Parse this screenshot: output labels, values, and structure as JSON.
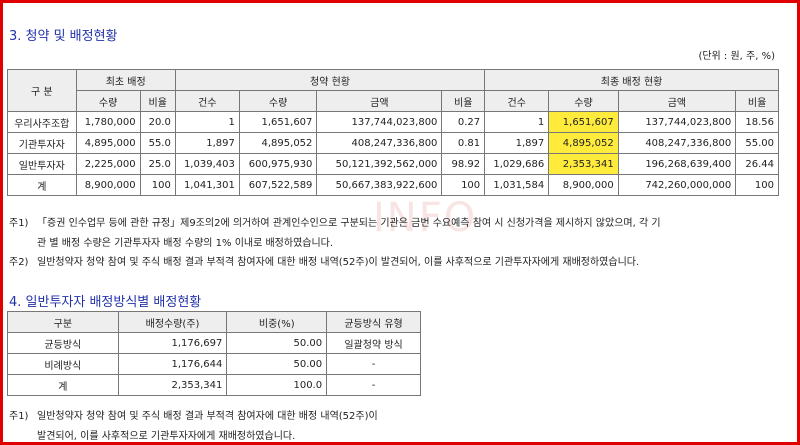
{
  "section3": {
    "title": "3. 청약 및 배정현황",
    "unit": "(단위 : 원, 주, %)",
    "header": {
      "classification": "구 분",
      "initial": "최초 배정",
      "subscription": "청약 현황",
      "final": "최종 배정 현황",
      "sub": [
        "수량",
        "비율",
        "건수",
        "수량",
        "금액",
        "비율",
        "건수",
        "수량",
        "금액",
        "비율"
      ]
    },
    "rows": [
      {
        "name": "우리사주조합",
        "vals": [
          "1,780,000",
          "20.0",
          "1",
          "1,651,607",
          "137,744,023,800",
          "0.27",
          "1",
          "1,651,607",
          "137,744,023,800",
          "18.56"
        ]
      },
      {
        "name": "기관투자자",
        "vals": [
          "4,895,000",
          "55.0",
          "1,897",
          "4,895,052",
          "408,247,336,800",
          "0.81",
          "1,897",
          "4,895,052",
          "408,247,336,800",
          "55.00"
        ]
      },
      {
        "name": "일반투자자",
        "vals": [
          "2,225,000",
          "25.0",
          "1,039,403",
          "600,975,930",
          "50,121,392,562,000",
          "98.92",
          "1,029,686",
          "2,353,341",
          "196,268,639,400",
          "26.44"
        ]
      },
      {
        "name": "계",
        "vals": [
          "8,900,000",
          "100",
          "1,041,301",
          "607,522,589",
          "50,667,383,922,600",
          "100",
          "1,031,584",
          "8,900,000",
          "742,260,000,000",
          "100"
        ]
      }
    ],
    "notes": [
      {
        "num": "주1)",
        "line1": "「증권 인수업무 등에 관한 규정」제9조의2에 의거하여 관계인수인으로 구분되는 기관은 금번 수요예측 참여 시 신청가격을 제시하지 않았으며, 각 기",
        "line2": "관 별 배정 수량은 기관투자자 배정 수량의 1% 이내로 배정하였습니다."
      },
      {
        "num": "주2)",
        "line1": "일반청약자 청약 참여 및 주식 배정 결과 부적격 참여자에 대한 배정 내역(52주)이 발견되어, 이를 사후적으로 기관투자자에게 재배정하였습니다."
      }
    ]
  },
  "watermark": "INFO",
  "section4": {
    "title": "4. 일반투자자 배정방식별 배정현황",
    "headers": [
      "구분",
      "배정수량(주)",
      "비중(%)",
      "균등방식 유형"
    ],
    "rows": [
      {
        "name": "균등방식",
        "qty": "1,176,697",
        "ratio": "50.00",
        "type": "일괄청약 방식"
      },
      {
        "name": "비례방식",
        "qty": "1,176,644",
        "ratio": "50.00",
        "type": "-"
      },
      {
        "name": "계",
        "qty": "2,353,341",
        "ratio": "100.0",
        "type": "-"
      }
    ],
    "note": {
      "num": "주1)",
      "line1": "일반청약자 청약 참여 및 주식 배정 결과 부적격 참여자에 대한 배정 내역(52주)이",
      "line2": "발견되어, 이를 사후적으로 기관투자자에게 재배정하였습니다."
    }
  },
  "colors": {
    "frame": "#e00000",
    "title": "#2233aa",
    "highlight": "#ffeb3b",
    "header_bg": "#eeeeee"
  }
}
